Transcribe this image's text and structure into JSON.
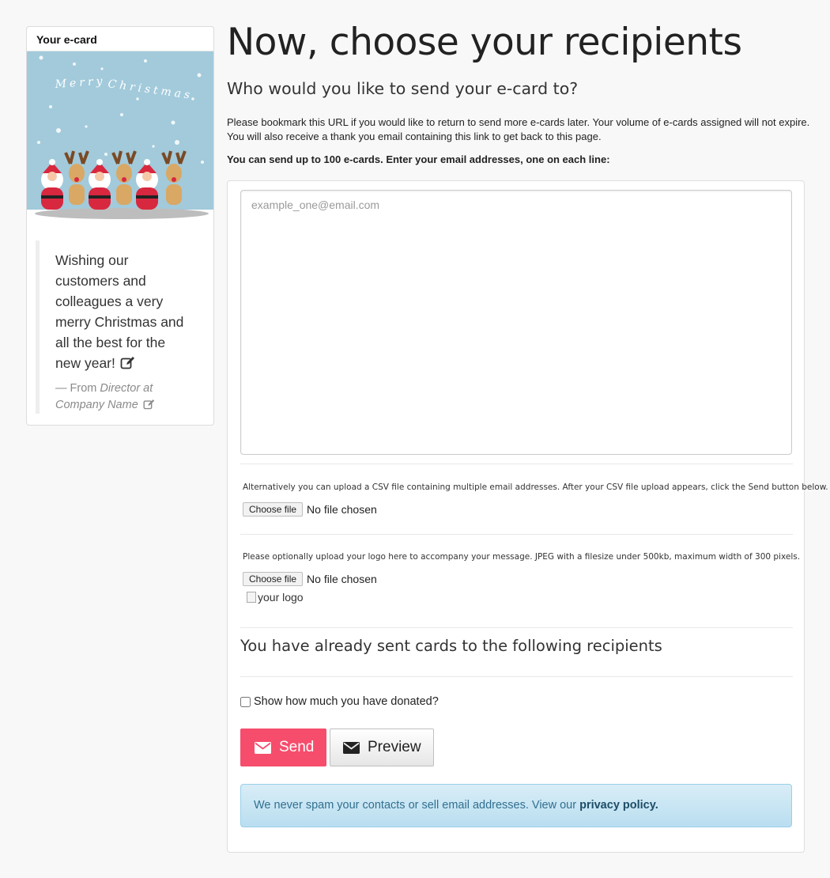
{
  "sidebar": {
    "heading": "Your e-card",
    "card_image_alt": "Merry Christmas",
    "message": "Wishing our customers and colleagues a very merry Christmas and all the best for the new year!",
    "from_prefix": "— From ",
    "from_name": "Director at Company Name"
  },
  "main": {
    "title": "Now, choose your recipients",
    "subtitle": "Who would you like to send your e-card to?",
    "intro": "Please bookmark this URL if you would like to return to send more e-cards later. Your volume of e-cards assigned will not expire. You will also receive a thank you email containing this link to get back to this page.",
    "instructions": "You can send up to 100 e-cards. Enter your email addresses, one on each line:"
  },
  "form": {
    "email_placeholder": "example_one@email.com",
    "csv_help": "Alternatively you can upload a CSV file containing multiple email addresses. After your CSV file upload appears, click the Send button below.",
    "csv_button": "Choose file",
    "csv_status": "No file chosen",
    "logo_help": "Please optionally upload your logo here to accompany your message. JPEG with a filesize under 500kb, maximum width of 300 pixels.",
    "logo_button": "Choose file",
    "logo_status": "No file chosen",
    "logo_alt": "your logo",
    "sent_heading": "You have already sent cards to the following recipients",
    "donate_label": "Show how much you have donated?",
    "donate_checked": false,
    "send_label": "Send",
    "preview_label": "Preview",
    "notice_text": "We never spam your contacts or sell email addresses. View our ",
    "notice_link": "privacy policy."
  },
  "colors": {
    "send_button": "#f64d6c",
    "card_background": "#a2cadb",
    "notice_background": "#d9edf7"
  },
  "icons": [
    "edit-icon",
    "envelope-icon"
  ]
}
